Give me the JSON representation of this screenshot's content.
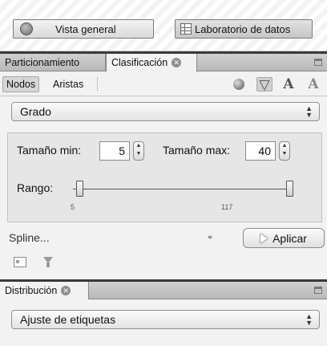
{
  "toolbar": {
    "overview_label": "Vista general",
    "data_lab_label": "Laboratorio de datos"
  },
  "top_tabs": {
    "partitioning": "Particionamiento",
    "ranking": "Clasificación",
    "close_glyph": "✕"
  },
  "sub_tabs": {
    "nodes": "Nodos",
    "edges": "Aristas"
  },
  "ranking": {
    "attribute": "Grado",
    "min_size_label": "Tamaño min:",
    "min_size_value": "5",
    "max_size_label": "Tamaño max:",
    "max_size_value": "40",
    "range_label": "Rango:",
    "range_min": "5",
    "range_max": "117",
    "range_selected_fraction": [
      0.0,
      1.0
    ],
    "spline_label": "Spline...",
    "apply_label": "Aplicar"
  },
  "distribution": {
    "tab_label": "Distribución",
    "close_glyph": "✕",
    "layout_option": "Ajuste de etiquetas"
  },
  "icons": {
    "overview": "globe-icon",
    "data_lab": "spreadsheet-icon",
    "color": "color-ball-icon",
    "size": "size-diamond-icon",
    "label_color": "label-color-icon",
    "label_size": "label-size-icon",
    "link": "link-icon",
    "apply": "play-icon",
    "result_list": "window-icon",
    "filter": "funnel-icon"
  },
  "colors": {
    "separator": "#3a3a3a",
    "panel": "#f2f2f2",
    "tab_strip": "#c4c4c4"
  }
}
